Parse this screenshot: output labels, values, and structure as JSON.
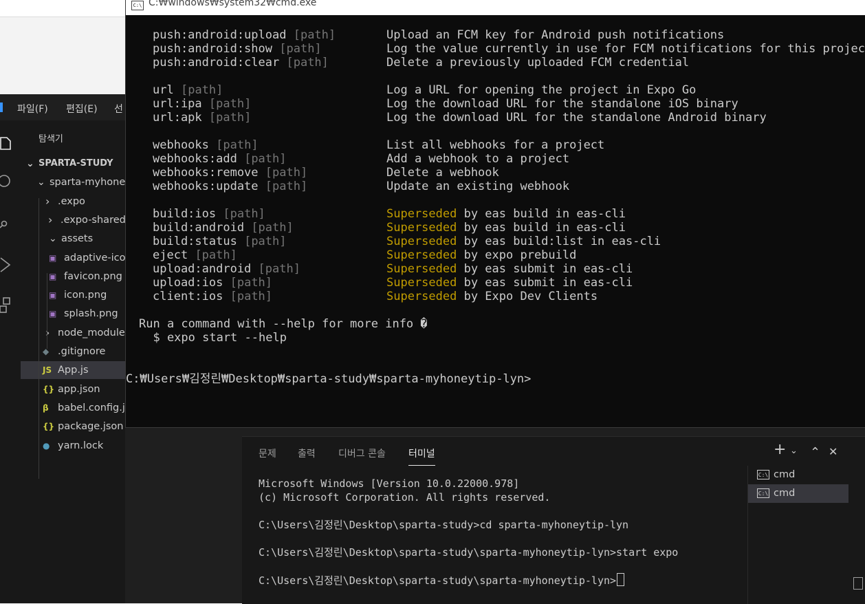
{
  "vscode": {
    "menu": [
      "파일(F)",
      "편집(E)",
      "선"
    ],
    "explorer_title": "탐색기",
    "tree": [
      {
        "label": "SPARTA-STUDY",
        "kind": "root",
        "chev": "⌄"
      },
      {
        "label": "sparta-myhoneytip-lyn",
        "kind": "folder",
        "chev": "⌄"
      },
      {
        "label": ".expo",
        "kind": "folder",
        "chev": "›"
      },
      {
        "label": ".expo-shared",
        "kind": "folder",
        "chev": "›"
      },
      {
        "label": "assets",
        "kind": "folder",
        "chev": "⌄"
      },
      {
        "label": "adaptive-icon.png",
        "kind": "image"
      },
      {
        "label": "favicon.png",
        "kind": "image"
      },
      {
        "label": "icon.png",
        "kind": "image"
      },
      {
        "label": "splash.png",
        "kind": "image"
      },
      {
        "label": "node_modules",
        "kind": "folder",
        "chev": "›"
      },
      {
        "label": ".gitignore",
        "kind": "git"
      },
      {
        "label": "App.js",
        "kind": "js"
      },
      {
        "label": "app.json",
        "kind": "json"
      },
      {
        "label": "babel.config.js",
        "kind": "babel"
      },
      {
        "label": "package.json",
        "kind": "json"
      },
      {
        "label": "yarn.lock",
        "kind": "yarn"
      }
    ],
    "panel_tabs": [
      "문제",
      "출력",
      "디버그 콘솔",
      "터미널"
    ],
    "panel_actions": {
      "add": "+",
      "dropdown": "⌄",
      "maximize": "⌃",
      "close": "✕"
    },
    "terminal_lines": [
      "Microsoft Windows [Version 10.0.22000.978]",
      "(c) Microsoft Corporation. All rights reserved.",
      "",
      "C:\\Users\\김정린\\Desktop\\sparta-study>cd sparta-myhoneytip-lyn",
      "",
      "C:\\Users\\김정린\\Desktop\\sparta-study\\sparta-myhoneytip-lyn>start expo",
      "",
      "C:\\Users\\김정린\\Desktop\\sparta-study\\sparta-myhoneytip-lyn>"
    ],
    "terminal_list": [
      {
        "icon": "C:\\",
        "name": "cmd",
        "selected": false
      },
      {
        "icon": "C:\\",
        "name": "cmd",
        "selected": true
      }
    ]
  },
  "cmd": {
    "icon": "C:\\",
    "title": "C:₩windows₩system32₩cmd.exe",
    "commands": [
      {
        "cmd": "push:android:upload",
        "arg": "[path]",
        "desc": "Upload an FCM key for Android push notifications"
      },
      {
        "cmd": "push:android:show",
        "arg": "[path]",
        "desc": "Log the value currently in use for FCM notifications for this project"
      },
      {
        "cmd": "push:android:clear",
        "arg": "[path]",
        "desc": "Delete a previously uploaded FCM credential"
      },
      {
        "blank": true
      },
      {
        "cmd": "url",
        "arg": "[path]",
        "desc": "Log a URL for opening the project in Expo Go"
      },
      {
        "cmd": "url:ipa",
        "arg": "[path]",
        "desc": "Log the download URL for the standalone iOS binary"
      },
      {
        "cmd": "url:apk",
        "arg": "[path]",
        "desc": "Log the download URL for the standalone Android binary"
      },
      {
        "blank": true
      },
      {
        "cmd": "webhooks",
        "arg": "[path]",
        "desc": "List all webhooks for a project"
      },
      {
        "cmd": "webhooks:add",
        "arg": "[path]",
        "desc": "Add a webhook to a project"
      },
      {
        "cmd": "webhooks:remove",
        "arg": "[path]",
        "desc": "Delete a webhook"
      },
      {
        "cmd": "webhooks:update",
        "arg": "[path]",
        "desc": "Update an existing webhook"
      },
      {
        "blank": true
      },
      {
        "cmd": "build:ios",
        "arg": "[path]",
        "hl": "Superseded",
        "desc": " by eas build in eas-cli"
      },
      {
        "cmd": "build:android",
        "arg": "[path]",
        "hl": "Superseded",
        "desc": " by eas build in eas-cli"
      },
      {
        "cmd": "build:status",
        "arg": "[path]",
        "hl": "Superseded",
        "desc": " by eas build:list in eas-cli"
      },
      {
        "cmd": "eject",
        "arg": "[path]",
        "hl": "Superseded",
        "desc": " by expo prebuild"
      },
      {
        "cmd": "upload:android",
        "arg": "[path]",
        "hl": "Superseded",
        "desc": " by eas submit in eas-cli"
      },
      {
        "cmd": "upload:ios",
        "arg": "[path]",
        "hl": "Superseded",
        "desc": " by eas submit in eas-cli"
      },
      {
        "cmd": "client:ios",
        "arg": "[path]",
        "hl": "Superseded",
        "desc": " by Expo Dev Clients"
      }
    ],
    "help_line": "Run a command with --help for more info �",
    "help_example": "  $ expo start --help",
    "prompt": "C:₩Users₩김정린₩Desktop₩sparta-study₩sparta-myhoneytip-lyn>"
  },
  "colors": {
    "highlight": "#c19c00",
    "muted": "#767676",
    "text": "#cccccc"
  }
}
